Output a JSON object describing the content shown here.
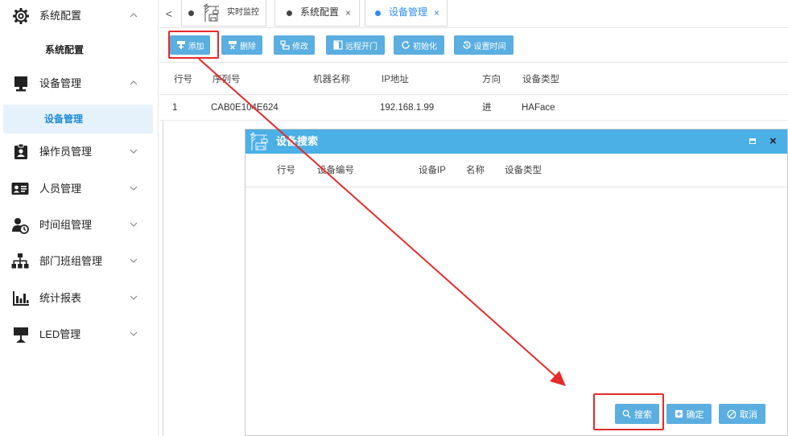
{
  "sidebar": {
    "groups": [
      {
        "label": "系统配置",
        "icon": "gear-icon",
        "expanded": true,
        "sub": "系统配置"
      },
      {
        "label": "设备管理",
        "icon": "monitor-icon",
        "expanded": true,
        "sub": "设备管理"
      },
      {
        "label": "操作员管理",
        "icon": "operator-badge-icon",
        "expanded": false
      },
      {
        "label": "人员管理",
        "icon": "id-card-icon",
        "expanded": false
      },
      {
        "label": "时间组管理",
        "icon": "user-clock-icon",
        "expanded": false
      },
      {
        "label": "部门班组管理",
        "icon": "org-chart-icon",
        "expanded": false
      },
      {
        "label": "统计报表",
        "icon": "bar-report-icon",
        "expanded": false
      },
      {
        "label": "LED管理",
        "icon": "led-stand-icon",
        "expanded": false
      }
    ]
  },
  "tabs": [
    {
      "label": "实时监控",
      "closable": false,
      "active": false
    },
    {
      "label": "系统配置",
      "closable": true,
      "active": false
    },
    {
      "label": "设备管理",
      "closable": true,
      "active": true
    }
  ],
  "tab_close_glyph": "×",
  "tab_prev_glyph": "<",
  "toolbar": {
    "add": "添加",
    "delete": "删除",
    "edit": "修改",
    "remote_open": "远程开门",
    "initialize": "初始化",
    "set_time": "设置时间"
  },
  "table": {
    "columns": [
      "行号",
      "序列号",
      "机器名称",
      "IP地址",
      "方向",
      "设备类型"
    ],
    "rows": [
      {
        "row_no": "1",
        "serial": "CAB0E104E624",
        "machine_name": "",
        "ip": "192.168.1.99",
        "direction": "进",
        "device_type": "HAFace"
      }
    ]
  },
  "modal": {
    "title": "设备搜索",
    "close_glyph": "×",
    "columns": [
      "行号",
      "设备编号",
      "设备IP",
      "名称",
      "设备类型"
    ],
    "search_button": "搜索",
    "confirm_button": "确定",
    "cancel_button": "取消"
  },
  "colors": {
    "accent": "#2d8cf0",
    "button_blue": "#5aaee0",
    "modal_header": "#4ab0e6",
    "highlight_red": "#e62a2a",
    "active_sub_bg": "#e6f2fb"
  }
}
